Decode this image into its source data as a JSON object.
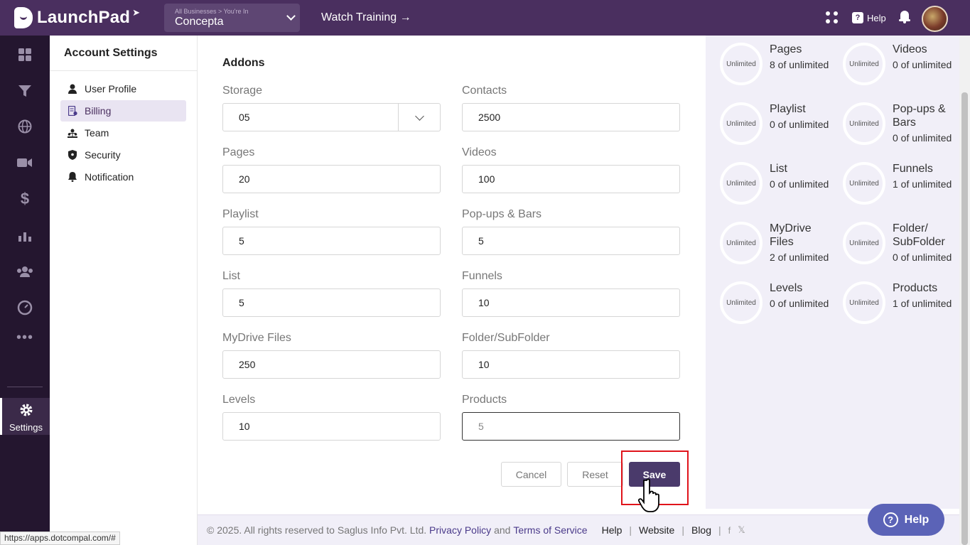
{
  "app": {
    "name": "LaunchPad"
  },
  "header": {
    "business_sub": "All Businesses > You're In",
    "business_name": "Concepta",
    "watch_training": "Watch Training →",
    "help_label": "Help"
  },
  "rail": {
    "settings_label": "Settings",
    "icons": [
      "dashboard-icon",
      "funnel-icon",
      "globe-icon",
      "video-icon",
      "dollar-icon",
      "analytics-icon",
      "users-icon",
      "speedometer-icon",
      "more-icon"
    ]
  },
  "account": {
    "title": "Account Settings",
    "items": [
      {
        "label": "User Profile",
        "icon": "user-icon"
      },
      {
        "label": "Billing",
        "icon": "billing-icon",
        "active": true
      },
      {
        "label": "Team",
        "icon": "team-icon"
      },
      {
        "label": "Security",
        "icon": "shield-icon"
      },
      {
        "label": "Notification",
        "icon": "bell-icon"
      }
    ]
  },
  "form": {
    "section_title": "Addons",
    "fields": {
      "storage": {
        "label": "Storage",
        "value": "05"
      },
      "contacts": {
        "label": "Contacts",
        "value": "2500"
      },
      "pages": {
        "label": "Pages",
        "value": "20"
      },
      "videos": {
        "label": "Videos",
        "value": "100"
      },
      "playlist": {
        "label": "Playlist",
        "value": "5"
      },
      "popups": {
        "label": "Pop-ups & Bars",
        "value": "5"
      },
      "list": {
        "label": "List",
        "value": "5"
      },
      "funnels": {
        "label": "Funnels",
        "value": "10"
      },
      "mydrive": {
        "label": "MyDrive Files",
        "value": "250"
      },
      "folder": {
        "label": "Folder/SubFolder",
        "value": "10"
      },
      "levels": {
        "label": "Levels",
        "value": "10"
      },
      "products": {
        "label": "Products",
        "value": "5"
      }
    },
    "cancel_label": "Cancel",
    "reset_label": "Reset",
    "save_label": "Save"
  },
  "usage": {
    "ring_label": "Unlimited",
    "items": [
      {
        "name": "Pages",
        "count": "8 of unlimited"
      },
      {
        "name": "Videos",
        "count": "0 of unlimited"
      },
      {
        "name": "Playlist",
        "count": "0 of unlimited"
      },
      {
        "name": "Pop-ups & Bars",
        "count": "0 of unlimited"
      },
      {
        "name": "List",
        "count": "0 of unlimited"
      },
      {
        "name": "Funnels",
        "count": "1 of unlimited"
      },
      {
        "name": "MyDrive Files",
        "count": "2 of unlimited"
      },
      {
        "name": "Folder/ SubFolder",
        "count": "0 of unlimited"
      },
      {
        "name": "Levels",
        "count": "0 of unlimited"
      },
      {
        "name": "Products",
        "count": "1 of unlimited"
      }
    ]
  },
  "footer": {
    "copyright": "©  2025. All rights reserved to Saglus Info Pvt. Ltd.",
    "privacy": "Privacy Policy",
    "and": "and",
    "terms": "Terms of Service",
    "help": "Help",
    "website": "Website",
    "blog": "Blog",
    "separator": "|",
    "facebook": "f",
    "x": "𝕏"
  },
  "help_button": "Help",
  "status_url": "https://apps.dotcompal.com/#",
  "colors": {
    "brand": "#4a2f5f",
    "rail": "#24162f",
    "panel": "#f1eff8",
    "save": "#4a3a6b",
    "highlight": "#e0141b"
  }
}
